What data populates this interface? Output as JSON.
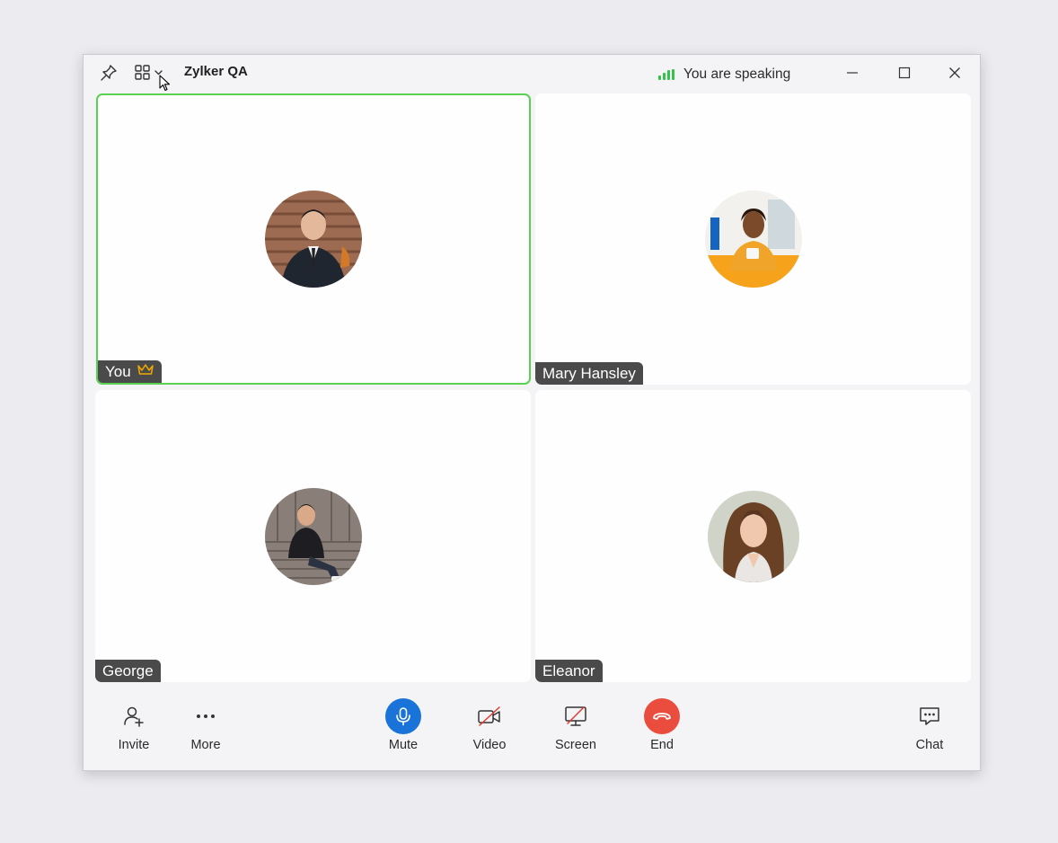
{
  "window": {
    "title": "Zylker QA"
  },
  "status": {
    "speaking_text": "You are speaking",
    "signal_color": "#33c24a"
  },
  "colors": {
    "active_border": "#59d151",
    "mute": "#1a73d8",
    "end": "#ea4d3d"
  },
  "participants": [
    {
      "name": "You",
      "host_icon": "crown-icon",
      "active": true
    },
    {
      "name": "Mary Hansley"
    },
    {
      "name": "George"
    },
    {
      "name": "Eleanor"
    }
  ],
  "controls": {
    "invite": "Invite",
    "more": "More",
    "mute": "Mute",
    "video": "Video",
    "screen": "Screen",
    "end": "End",
    "chat": "Chat"
  }
}
